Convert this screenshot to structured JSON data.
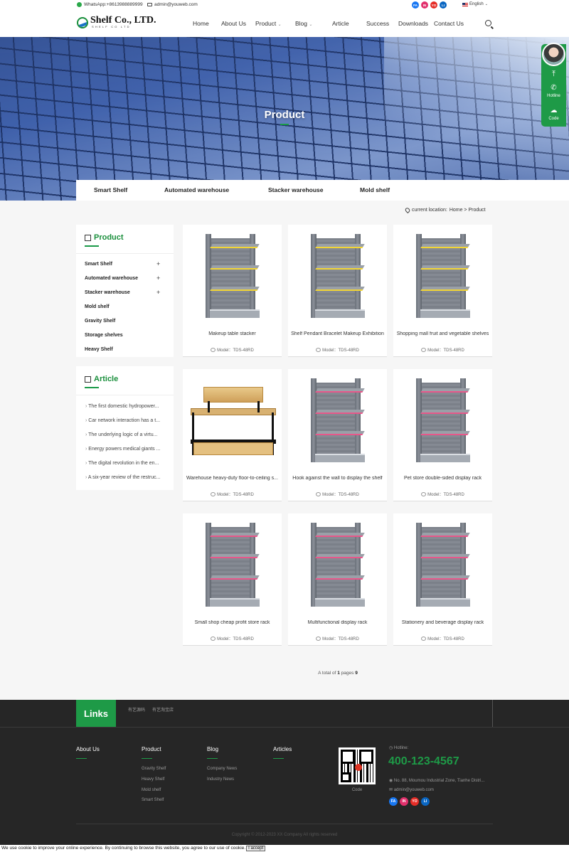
{
  "topbar": {
    "whatsapp": "WhatsApp:+8613988889999",
    "email": "admin@youweb.com",
    "language": "English",
    "socials": [
      {
        "label": "FA",
        "color": "#1877f2"
      },
      {
        "label": "IN",
        "color": "#e1306c"
      },
      {
        "label": "YO",
        "color": "#e52d27"
      },
      {
        "label": "LI",
        "color": "#0a66c2"
      }
    ]
  },
  "header": {
    "logo_name": "Shelf Co., LTD.",
    "logo_sub": "SHELF CO LTD",
    "nav": [
      "Home",
      "About Us",
      "Product",
      "Blog",
      "Article",
      "Success",
      "Downloads",
      "Contact Us"
    ]
  },
  "banner": {
    "title": "Product"
  },
  "subnav": [
    "Smart Shelf",
    "Automated warehouse",
    "Stacker warehouse",
    "Mold shelf"
  ],
  "float": {
    "hotline": "Hotline",
    "code": "Code"
  },
  "breadcrumb": {
    "label": "current location:",
    "path": "Home > Product"
  },
  "sidebar": {
    "product_title": "Product",
    "categories": [
      {
        "label": "Smart Shelf",
        "expand": "+"
      },
      {
        "label": "Automated warehouse",
        "expand": "+"
      },
      {
        "label": "Stacker warehouse",
        "expand": "+"
      },
      {
        "label": "Mold shelf",
        "expand": ""
      },
      {
        "label": "Gravity Shelf",
        "expand": ""
      },
      {
        "label": "Storage shelves",
        "expand": ""
      },
      {
        "label": "Heavy Shelf",
        "expand": ""
      }
    ],
    "article_title": "Article",
    "articles": [
      "The first domestic hydropower...",
      "Car network interaction has a t...",
      "The underlying logic of a virtu...",
      "Energy powers medical giants ...",
      "The digital revolution in the en...",
      "A six-year review of the restruc..."
    ]
  },
  "products": [
    {
      "title": "Makeup table stacker",
      "model": "Model：TDS-48RD",
      "type": "shelf",
      "accent": "#f2d535"
    },
    {
      "title": "Shelf Pendant Bracelet Makeup Exhibition",
      "model": "Model：TDS-48RD",
      "type": "shelf",
      "accent": "#f2d535"
    },
    {
      "title": "Shopping mall fruit and vegetable shelves",
      "model": "Model：TDS-48RD",
      "type": "shelf",
      "accent": "#f2d535"
    },
    {
      "title": "Warehouse heavy-duty floor-to-ceiling s...",
      "model": "Model：TDS-48RD",
      "type": "table",
      "accent": "#d8b171"
    },
    {
      "title": "Hook against the wall to display the shelf",
      "model": "Model：TDS-48RD",
      "type": "shelf",
      "accent": "#e8578a"
    },
    {
      "title": "Pet store double-sided display rack",
      "model": "Model：TDS-48RD",
      "type": "shelf",
      "accent": "#e8578a"
    },
    {
      "title": "Small shop cheap profit store rack",
      "model": "Model：TDS-48RD",
      "type": "shelf",
      "accent": "#e8578a"
    },
    {
      "title": "Multifunctional display rack",
      "model": "Model：TDS-48RD",
      "type": "shelf",
      "accent": "#e8578a"
    },
    {
      "title": "Stationery and beverage display rack",
      "model": "Model：TDS-48RD",
      "type": "shelf",
      "accent": "#e8578a"
    }
  ],
  "pager": {
    "prefix": "A total of",
    "count": "1",
    "mid": "pages",
    "pages": "9"
  },
  "footer": {
    "links_title": "Links",
    "links": [
      "有艺源码",
      "有艺淘宝店"
    ],
    "columns": [
      {
        "title": "About Us",
        "items": []
      },
      {
        "title": "Product",
        "items": [
          "Gravity Shelf",
          "Heavy Shelf",
          "Mold shelf",
          "Smart Shelf"
        ]
      },
      {
        "title": "Blog",
        "items": [
          "Company News",
          "Industry News"
        ]
      },
      {
        "title": "Articles",
        "items": []
      }
    ],
    "qr_label": "Code",
    "hotline_label": "Hotline:",
    "hotline": "400-123-4567",
    "address": "No. 88, Moumou Industrial Zone, Tianhe Distri...",
    "email": "admin@youweb.com",
    "copyright": "Copyright © 2012-2023 XX Company All rights reserved"
  },
  "cookie": {
    "text": "We use cookie to improve your online experience. By continuing to browse this website, you agree to our use of cookie.",
    "button": "I accept"
  },
  "colors": {
    "brand_green": "#1e9a47",
    "footer_bg": "#262626"
  }
}
